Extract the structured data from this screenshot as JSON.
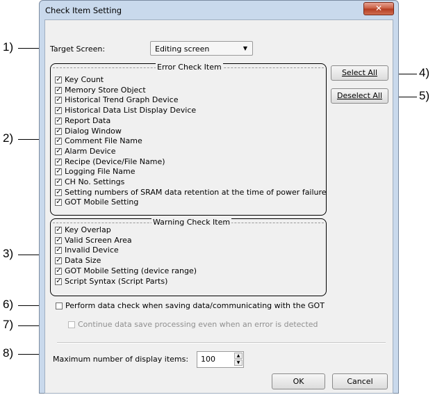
{
  "dialog": {
    "title": "Check Item Setting",
    "close_glyph": "✕"
  },
  "target_screen": {
    "label": "Target Screen:",
    "value": "Editing screen"
  },
  "error_group": {
    "caption": "Error Check Item",
    "items": [
      "Key Count",
      "Memory Store Object",
      "Historical Trend Graph Device",
      "Historical Data List Display Device",
      "Report Data",
      "Dialog Window",
      "Comment File Name",
      "Alarm Device",
      "Recipe (Device/File Name)",
      "Logging File Name",
      "CH No. Settings",
      "Setting numbers of SRAM data retention at the time of power failure",
      "GOT Mobile Setting"
    ]
  },
  "warning_group": {
    "caption": "Warning Check Item",
    "items": [
      "Key Overlap",
      "Valid Screen Area",
      "Invalid Device",
      "Data Size",
      "GOT Mobile Setting (device range)",
      "Script Syntax (Script Parts)"
    ]
  },
  "buttons": {
    "select_all": "Select All",
    "deselect_all": "Deselect All",
    "ok": "OK",
    "cancel": "Cancel"
  },
  "options": {
    "perform_check": "Perform data check when saving data/communicating with the GOT",
    "continue_save": "Continue data save processing even when an error is detected"
  },
  "max_items": {
    "label": "Maximum number of display items:",
    "value": "100"
  },
  "callouts": [
    "1)",
    "2)",
    "3)",
    "4)",
    "5)",
    "6)",
    "7)",
    "8)"
  ]
}
